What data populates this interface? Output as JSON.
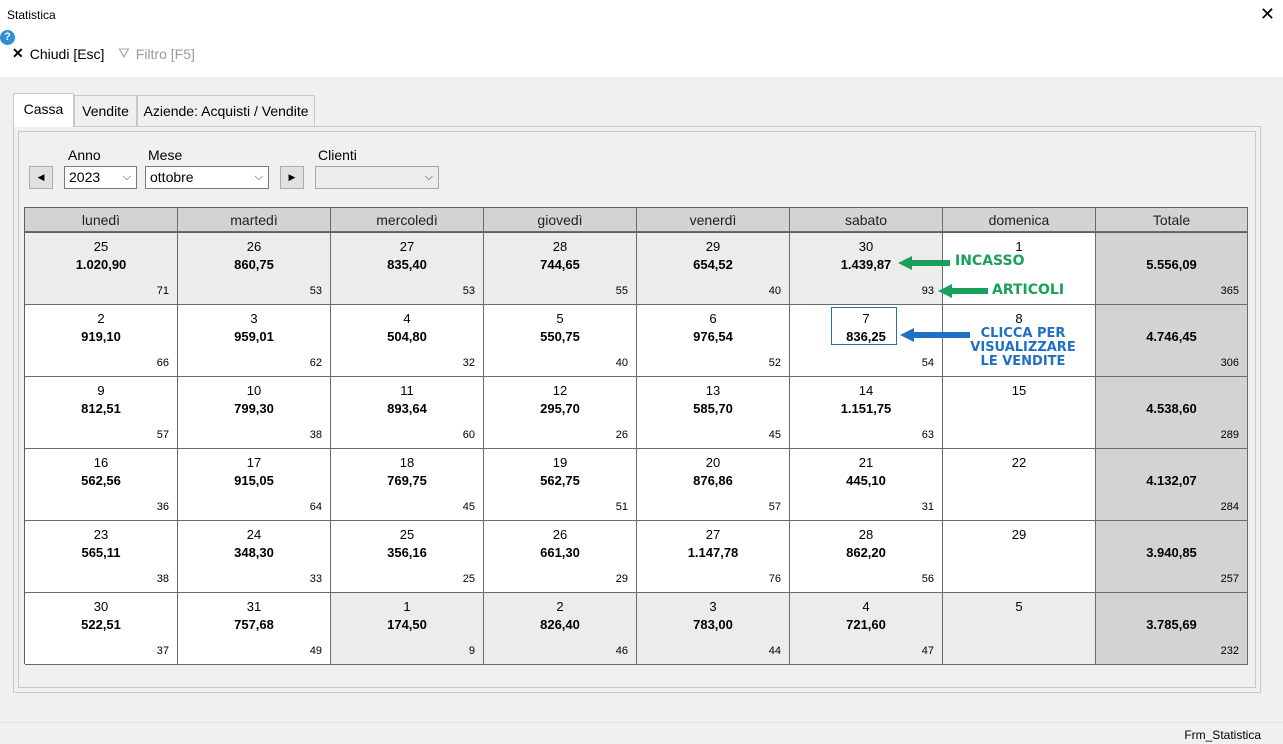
{
  "window": {
    "title": "Statistica",
    "status": "Frm_Statistica"
  },
  "toolbar": {
    "close_label": "Chiudi [Esc]",
    "filter_label": "Filtro [F5]",
    "help": "?"
  },
  "tabs": [
    {
      "label": "Cassa",
      "active": true
    },
    {
      "label": "Vendite",
      "active": false
    },
    {
      "label": "Aziende: Acquisti / Vendite",
      "active": false
    }
  ],
  "filters": {
    "anno_label": "Anno",
    "anno_value": "2023",
    "mese_label": "Mese",
    "mese_value": "ottobre",
    "clienti_label": "Clienti",
    "clienti_value": ""
  },
  "calendar": {
    "headers": [
      "lunedì",
      "martedì",
      "mercoledì",
      "giovedì",
      "venerdì",
      "sabato",
      "domenica",
      "Totale"
    ],
    "weeks": [
      {
        "days": [
          {
            "day": "25",
            "amount": "1.020,90",
            "count": "71",
            "other": true
          },
          {
            "day": "26",
            "amount": "860,75",
            "count": "53",
            "other": true
          },
          {
            "day": "27",
            "amount": "835,40",
            "count": "53",
            "other": true
          },
          {
            "day": "28",
            "amount": "744,65",
            "count": "55",
            "other": true
          },
          {
            "day": "29",
            "amount": "654,52",
            "count": "40",
            "other": true
          },
          {
            "day": "30",
            "amount": "1.439,87",
            "count": "93",
            "other": true
          },
          {
            "day": "1",
            "amount": "",
            "count": "",
            "other": false
          }
        ],
        "total": {
          "amount": "5.556,09",
          "count": "365"
        }
      },
      {
        "days": [
          {
            "day": "2",
            "amount": "919,10",
            "count": "66",
            "other": false
          },
          {
            "day": "3",
            "amount": "959,01",
            "count": "62",
            "other": false
          },
          {
            "day": "4",
            "amount": "504,80",
            "count": "32",
            "other": false
          },
          {
            "day": "5",
            "amount": "550,75",
            "count": "40",
            "other": false
          },
          {
            "day": "6",
            "amount": "976,54",
            "count": "52",
            "other": false
          },
          {
            "day": "7",
            "amount": "836,25",
            "count": "54",
            "other": false,
            "selected": true
          },
          {
            "day": "8",
            "amount": "",
            "count": "",
            "other": false
          }
        ],
        "total": {
          "amount": "4.746,45",
          "count": "306"
        }
      },
      {
        "days": [
          {
            "day": "9",
            "amount": "812,51",
            "count": "57",
            "other": false
          },
          {
            "day": "10",
            "amount": "799,30",
            "count": "38",
            "other": false
          },
          {
            "day": "11",
            "amount": "893,64",
            "count": "60",
            "other": false
          },
          {
            "day": "12",
            "amount": "295,70",
            "count": "26",
            "other": false
          },
          {
            "day": "13",
            "amount": "585,70",
            "count": "45",
            "other": false
          },
          {
            "day": "14",
            "amount": "1.151,75",
            "count": "63",
            "other": false
          },
          {
            "day": "15",
            "amount": "",
            "count": "",
            "other": false
          }
        ],
        "total": {
          "amount": "4.538,60",
          "count": "289"
        }
      },
      {
        "days": [
          {
            "day": "16",
            "amount": "562,56",
            "count": "36",
            "other": false
          },
          {
            "day": "17",
            "amount": "915,05",
            "count": "64",
            "other": false
          },
          {
            "day": "18",
            "amount": "769,75",
            "count": "45",
            "other": false
          },
          {
            "day": "19",
            "amount": "562,75",
            "count": "51",
            "other": false
          },
          {
            "day": "20",
            "amount": "876,86",
            "count": "57",
            "other": false
          },
          {
            "day": "21",
            "amount": "445,10",
            "count": "31",
            "other": false
          },
          {
            "day": "22",
            "amount": "",
            "count": "",
            "other": false
          }
        ],
        "total": {
          "amount": "4.132,07",
          "count": "284"
        }
      },
      {
        "days": [
          {
            "day": "23",
            "amount": "565,11",
            "count": "38",
            "other": false
          },
          {
            "day": "24",
            "amount": "348,30",
            "count": "33",
            "other": false
          },
          {
            "day": "25",
            "amount": "356,16",
            "count": "25",
            "other": false
          },
          {
            "day": "26",
            "amount": "661,30",
            "count": "29",
            "other": false
          },
          {
            "day": "27",
            "amount": "1.147,78",
            "count": "76",
            "other": false
          },
          {
            "day": "28",
            "amount": "862,20",
            "count": "56",
            "other": false
          },
          {
            "day": "29",
            "amount": "",
            "count": "",
            "other": false
          }
        ],
        "total": {
          "amount": "3.940,85",
          "count": "257"
        }
      },
      {
        "days": [
          {
            "day": "30",
            "amount": "522,51",
            "count": "37",
            "other": false
          },
          {
            "day": "31",
            "amount": "757,68",
            "count": "49",
            "other": false
          },
          {
            "day": "1",
            "amount": "174,50",
            "count": "9",
            "other": true
          },
          {
            "day": "2",
            "amount": "826,40",
            "count": "46",
            "other": true
          },
          {
            "day": "3",
            "amount": "783,00",
            "count": "44",
            "other": true
          },
          {
            "day": "4",
            "amount": "721,60",
            "count": "47",
            "other": true
          },
          {
            "day": "5",
            "amount": "",
            "count": "",
            "other": true
          }
        ],
        "total": {
          "amount": "3.785,69",
          "count": "232"
        }
      }
    ]
  },
  "annotations": {
    "incasso": "INCASSO",
    "articoli": "ARTICOLI",
    "clicca_line1": "CLICCA PER",
    "clicca_line2": "VISUALIZZARE",
    "clicca_line3": "LE VENDITE",
    "green_color": "#19a05a",
    "blue_color": "#1f6fc2"
  }
}
